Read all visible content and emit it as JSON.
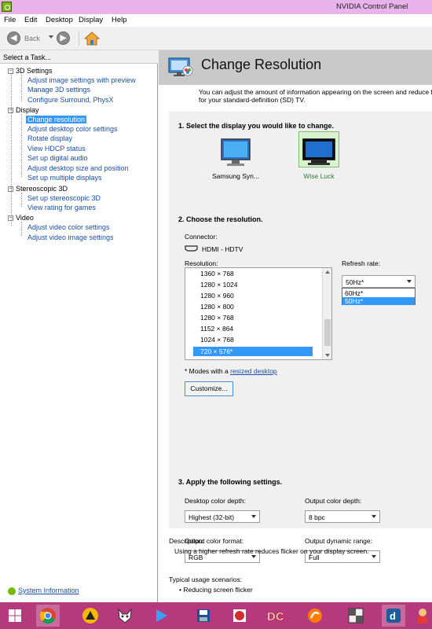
{
  "window": {
    "title": "NVIDIA Control Panel"
  },
  "menu": [
    "File",
    "Edit",
    "Desktop",
    "Display",
    "Help"
  ],
  "toolbar": {
    "back_label": "Back"
  },
  "left_pane": {
    "header": "Select a Task...",
    "categories": [
      {
        "label": "3D Settings",
        "items": [
          "Adjust image settings with preview",
          "Manage 3D settings",
          "Configure Surround, PhysX"
        ]
      },
      {
        "label": "Display",
        "items": [
          "Change resolution",
          "Adjust desktop color settings",
          "Rotate display",
          "View HDCP status",
          "Set up digital audio",
          "Adjust desktop size and position",
          "Set up multiple displays"
        ]
      },
      {
        "label": "Stereoscopic 3D",
        "items": [
          "Set up stereoscopic 3D",
          "View rating for games"
        ]
      },
      {
        "label": "Video",
        "items": [
          "Adjust video color settings",
          "Adjust video image settings"
        ]
      }
    ],
    "selected_item": "Change resolution",
    "system_info": "System Information"
  },
  "main": {
    "title": "Change Resolution",
    "description": "You can adjust the amount of information appearing on the screen and reduce flicker. Select a standard (high-definition) HD format or for your standard-definition (SD) TV.",
    "description_line1": "You can adjust the amount of information appearing on the screen and reduce fl",
    "description_line2": "for your standard-definition (SD) TV.",
    "step1": "1. Select the display you would like to change.",
    "displays": [
      {
        "name": "Samsung Syn...",
        "selected": false
      },
      {
        "name": "Wise Luck",
        "selected": true
      }
    ],
    "step2": "2. Choose the resolution.",
    "connector_label": "Connector:",
    "connector_value": "HDMI - HDTV",
    "resolution_label": "Resolution:",
    "resolutions": [
      "1360 × 768",
      "1280 × 1024",
      "1280 × 960",
      "1280 × 800",
      "1280 × 768",
      "1152 × 864",
      "1024 × 768",
      "720 × 576*"
    ],
    "selected_resolution": "720 × 576*",
    "refresh_label": "Refresh rate:",
    "refresh_value": "50Hz*",
    "refresh_options": [
      "60Hz*",
      "50Hz*"
    ],
    "modes_note_prefix": "* Modes with a",
    "modes_note_link": "resized desktop",
    "customize_button": "Customize...",
    "step3": "3. Apply the following settings.",
    "desktop_color_depth_label": "Desktop color depth:",
    "desktop_color_depth_value": "Highest (32-bit)",
    "output_color_depth_label": "Output color depth:",
    "output_color_depth_value": "8 bpc",
    "output_color_format_label": "Output color format:",
    "output_color_format_value": "RGB",
    "output_dynamic_range_label": "Output dynamic range:",
    "output_dynamic_range_value": "Full",
    "description_head": "Description:",
    "description_text": "Using a higher refresh rate reduces flicker on your display screen.",
    "usage_head": "Typical usage scenarios:",
    "usage_item": "Reducing screen flicker"
  },
  "taskbar": {
    "color": "#b43a7d",
    "icons": [
      "windows-start-icon",
      "chrome-icon",
      "aimp-icon",
      "fox-icon",
      "media-player-icon",
      "save-app-icon",
      "red-app-icon",
      "dc-app-icon",
      "orange-app-icon",
      "chess-app-icon",
      "d-app-icon",
      "person-app-icon"
    ]
  },
  "colors": {
    "accent": "#3399ff",
    "nvidia_green": "#76b900",
    "link": "#1a4fa3"
  }
}
